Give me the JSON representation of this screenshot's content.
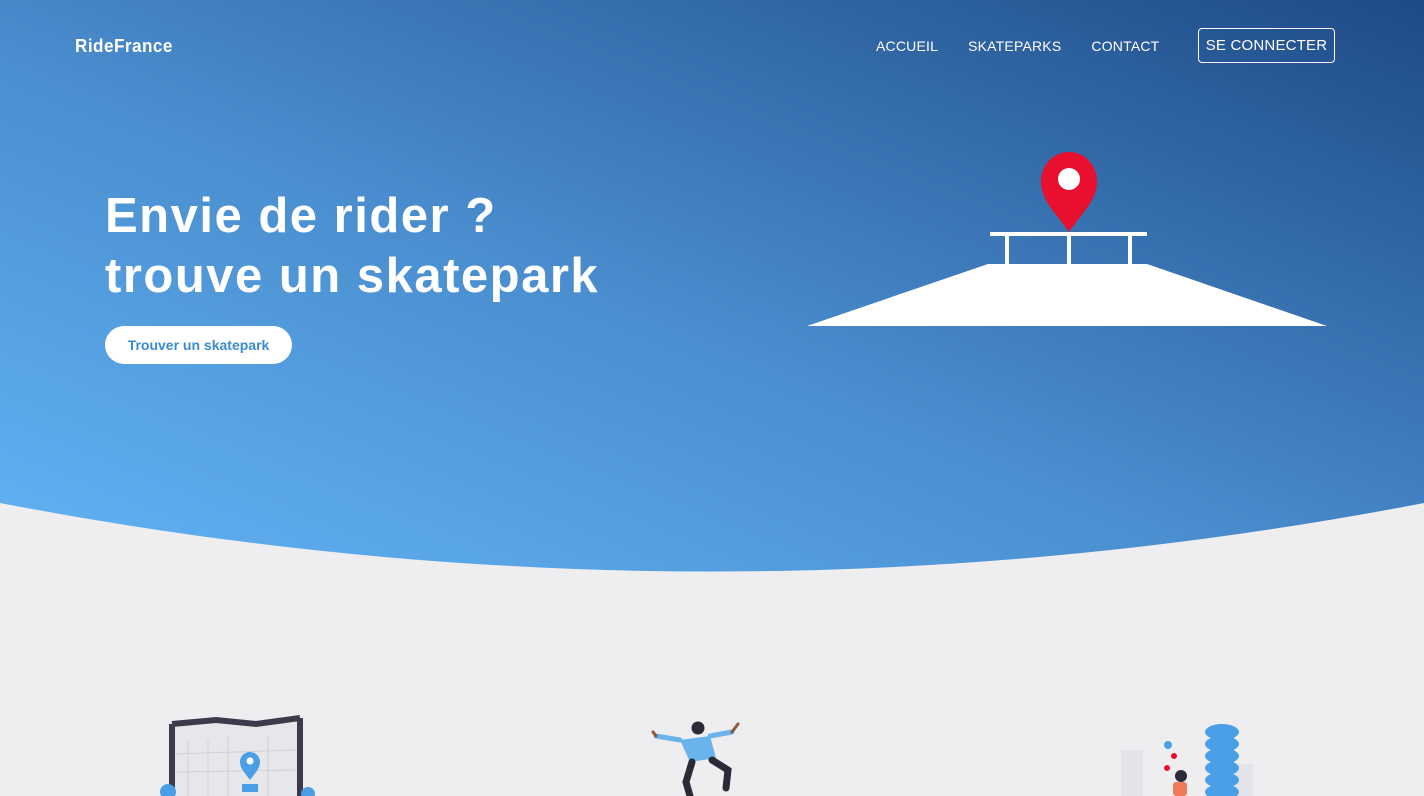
{
  "navbar": {
    "brand": "RideFrance",
    "links": [
      "ACCUEIL",
      "SKATEPARKS",
      "CONTACT"
    ],
    "login_label": "SE CONNECTER"
  },
  "hero": {
    "title_line1": "Envie de rider ?",
    "title_line2": "trouve un skatepark",
    "cta_label": "Trouver un skatepark"
  },
  "colors": {
    "gradient_start": "#62b4f5",
    "gradient_end": "#1e4a87",
    "background": "#eeeef0",
    "pin_red": "#e8102e",
    "cta_text": "#3a8bd0"
  },
  "icons": {
    "hero": "skatepark-pin-illustration",
    "features": [
      "map-illustration",
      "skater-illustration",
      "social-city-illustration"
    ]
  }
}
